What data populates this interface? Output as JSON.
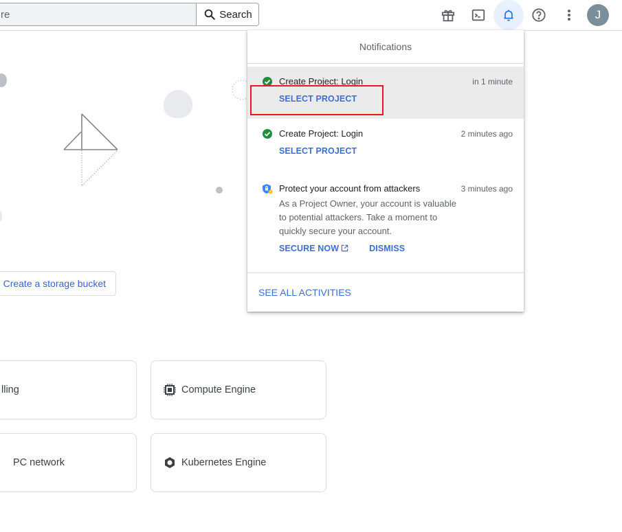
{
  "topbar": {
    "search": {
      "value": "re",
      "placeholder": "Search",
      "button_label": "Search"
    },
    "icons": [
      "gift-icon",
      "cloud-shell-icon",
      "notifications-bell-icon",
      "help-icon",
      "more-vert-icon"
    ],
    "avatar_initial": "J"
  },
  "main": {
    "bucket_button_label": "Create a storage bucket",
    "cards": [
      {
        "label": "lling",
        "icon": ""
      },
      {
        "label": "Compute Engine",
        "icon": "chip-icon"
      },
      {
        "label": "PC network",
        "icon": ""
      },
      {
        "label": "Kubernetes Engine",
        "icon": "kubernetes-hex-icon"
      }
    ]
  },
  "notifications": {
    "title": "Notifications",
    "items": [
      {
        "icon": "check-circle-icon",
        "title": "Create Project: Login",
        "time": "in 1 minute",
        "action": "SELECT PROJECT"
      },
      {
        "icon": "check-circle-icon",
        "title": "Create Project: Login",
        "time": "2 minutes ago",
        "action": "SELECT PROJECT"
      },
      {
        "icon": "security-shield-icon",
        "title": "Protect your account from attackers",
        "time": "3 minutes ago",
        "body": "As a Project Owner, your account is valuable to potential attackers. Take a moment to quickly secure your account.",
        "actions": [
          "SECURE NOW",
          "DISMISS"
        ]
      }
    ],
    "footer_link": "SEE ALL ACTIVITIES"
  },
  "colors": {
    "accent": "#3b6ed6",
    "success": "#1e8e3e",
    "highlight_box": "#e3191e",
    "active_icon_bg": "#e8f0fe"
  }
}
